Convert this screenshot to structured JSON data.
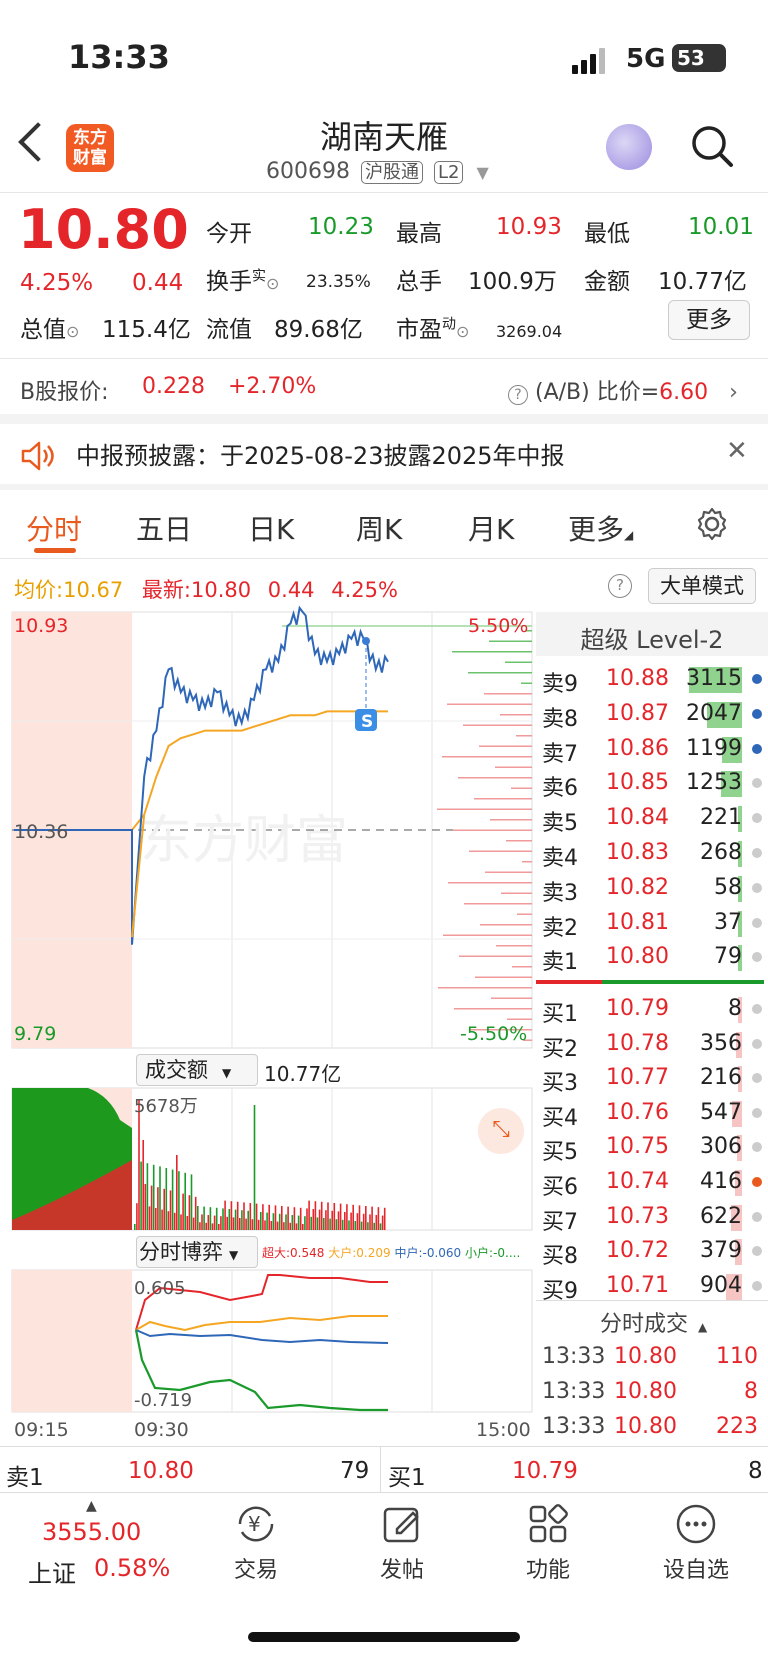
{
  "status_bar": {
    "time": "13:33",
    "network": "5G",
    "battery": "53"
  },
  "header": {
    "logo": "东方财富",
    "stock_name": "湖南天雁",
    "stock_code": "600698",
    "tag_connect": "沪股通",
    "tag_level": "L2"
  },
  "quote": {
    "price": "10.80",
    "change_pct": "4.25%",
    "change": "0.44",
    "open_label": "今开",
    "open": "10.23",
    "high_label": "最高",
    "high": "10.93",
    "low_label": "最低",
    "low": "10.01",
    "turnover_label": "换手",
    "turnover_sup": "实",
    "turnover": "23.35%",
    "volume_label": "总手",
    "volume": "100.9万",
    "amount_label": "金额",
    "amount": "10.77亿",
    "mktcap_label": "总值",
    "mktcap": "115.4亿",
    "float_label": "流值",
    "float_cap": "89.68亿",
    "pe_label": "市盈",
    "pe_sup": "动",
    "pe": "3269.04",
    "more_button": "更多"
  },
  "b_share": {
    "label": "B股报价:",
    "price": "0.228",
    "change": "+2.70%",
    "ratio_label": "(A/B) 比价=",
    "ratio": "6.60"
  },
  "notice": {
    "text": "中报预披露：于2025-08-23披露2025年中报"
  },
  "tabs": [
    "分时",
    "五日",
    "日K",
    "周K",
    "月K",
    "更多"
  ],
  "intraday": {
    "avg_label": "均价:",
    "avg": "10.67",
    "latest_label": "最新:",
    "latest": "10.80",
    "latest_change": "0.44",
    "latest_pct": "4.25%",
    "big_order_button": "大单模式",
    "y_top": "10.93",
    "y_mid": "10.36",
    "y_bottom": "9.79",
    "pct_top": "5.50%",
    "pct_bottom": "-5.50%",
    "marker": "S",
    "watermark": "东方财富",
    "turnover_selector": "成交额",
    "turnover_total": "10.77亿",
    "turnover_max": "5678万",
    "flow_selector": "分时博弈",
    "flow_super": "超大:0.548",
    "flow_big": "大户:0.209",
    "flow_mid": "中户:-0.060",
    "flow_small": "小户:-0....",
    "flow_top": "0.605",
    "flow_bottom": "-0.719",
    "time_start": "09:15",
    "time_open": "09:30",
    "time_end": "15:00"
  },
  "chart_data": {
    "type": "line",
    "title": "",
    "x": [
      "09:15",
      "09:25",
      "09:30",
      "09:32",
      "09:35",
      "09:40",
      "09:45",
      "09:50",
      "09:55",
      "10:00",
      "10:10",
      "10:20",
      "10:30",
      "10:40",
      "10:50",
      "11:00",
      "11:10",
      "11:20",
      "11:30",
      "13:00",
      "13:10",
      "13:20",
      "13:30",
      "13:33"
    ],
    "series": [
      {
        "name": "最新",
        "values": [
          10.36,
          10.36,
          10.36,
          10.5,
          10.62,
          10.78,
          10.72,
          10.7,
          10.68,
          10.72,
          10.66,
          10.64,
          10.7,
          10.78,
          10.8,
          10.9,
          10.93,
          10.82,
          10.8,
          10.82,
          10.86,
          10.86,
          10.78,
          10.8
        ]
      },
      {
        "name": "均价",
        "values": [
          10.36,
          10.36,
          10.36,
          10.4,
          10.5,
          10.58,
          10.6,
          10.61,
          10.62,
          10.62,
          10.62,
          10.62,
          10.63,
          10.64,
          10.65,
          10.66,
          10.66,
          10.66,
          10.67,
          10.67,
          10.67,
          10.67,
          10.67,
          10.67
        ]
      }
    ],
    "ylim": [
      9.79,
      10.93
    ]
  },
  "order_book": {
    "title": "超级 Level-2",
    "asks": [
      {
        "label": "卖9",
        "price": "10.88",
        "vol": "3115",
        "bar": 0.95
      },
      {
        "label": "卖8",
        "price": "10.87",
        "vol": "2047",
        "bar": 0.62
      },
      {
        "label": "卖7",
        "price": "10.86",
        "vol": "1199",
        "bar": 0.36
      },
      {
        "label": "卖6",
        "price": "10.85",
        "vol": "1253",
        "bar": 0.38
      },
      {
        "label": "卖5",
        "price": "10.84",
        "vol": "221",
        "bar": 0.07
      },
      {
        "label": "卖4",
        "price": "10.83",
        "vol": "268",
        "bar": 0.08
      },
      {
        "label": "卖3",
        "price": "10.82",
        "vol": "58",
        "bar": 0.02
      },
      {
        "label": "卖2",
        "price": "10.81",
        "vol": "37",
        "bar": 0.01
      },
      {
        "label": "卖1",
        "price": "10.80",
        "vol": "79",
        "bar": 0.02
      }
    ],
    "bids": [
      {
        "label": "买1",
        "price": "10.79",
        "vol": "8",
        "bar": 0.01
      },
      {
        "label": "买2",
        "price": "10.78",
        "vol": "356",
        "bar": 0.11
      },
      {
        "label": "买3",
        "price": "10.77",
        "vol": "216",
        "bar": 0.07
      },
      {
        "label": "买4",
        "price": "10.76",
        "vol": "547",
        "bar": 0.17
      },
      {
        "label": "买5",
        "price": "10.75",
        "vol": "306",
        "bar": 0.09
      },
      {
        "label": "买6",
        "price": "10.74",
        "vol": "416",
        "bar": 0.13
      },
      {
        "label": "买7",
        "price": "10.73",
        "vol": "622",
        "bar": 0.19
      },
      {
        "label": "买8",
        "price": "10.72",
        "vol": "379",
        "bar": 0.12
      },
      {
        "label": "买9",
        "price": "10.71",
        "vol": "904",
        "bar": 0.28
      }
    ],
    "ticks_title": "分时成交",
    "ticks": [
      {
        "time": "13:33",
        "price": "10.80",
        "vol": "110"
      },
      {
        "time": "13:33",
        "price": "10.80",
        "vol": "8"
      },
      {
        "time": "13:33",
        "price": "10.80",
        "vol": "223"
      }
    ]
  },
  "bottom_quote": {
    "ask_label": "卖1",
    "ask_price": "10.80",
    "ask_vol": "79",
    "bid_label": "买1",
    "bid_price": "10.79",
    "bid_vol": "8"
  },
  "bottom_nav": {
    "index_value": "3555.00",
    "index_name": "上证",
    "index_pct": "0.58%",
    "items": [
      "交易",
      "发帖",
      "功能",
      "设自选"
    ]
  }
}
